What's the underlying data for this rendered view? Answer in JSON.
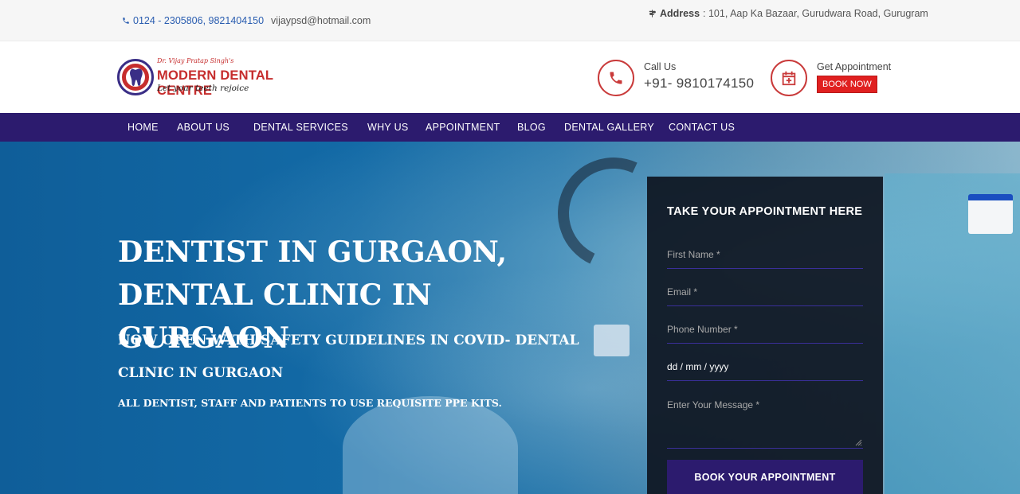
{
  "topbar": {
    "phones": "0124 - 2305806, 9821404150",
    "email": "vijaypsd@hotmail.com",
    "address_label": "Address",
    "address_value": ": 101, Aap Ka Bazaar, Gurudwara Road, Gurugram"
  },
  "logo": {
    "doctor": "Dr. Vijay Pratap Singh's",
    "brand": "MODERN DENTAL CENTRE",
    "tagline": "Let your teeth rejoice"
  },
  "header": {
    "call_label": "Call Us",
    "call_number": "+91- 9810174150",
    "appointment_label": "Get Appointment",
    "book_now": "BOOK NOW"
  },
  "nav": {
    "items": [
      "HOME",
      "ABOUT US",
      "DENTAL SERVICES",
      "WHY US",
      "APPOINTMENT",
      "BLOG",
      "DENTAL GALLERY",
      "CONTACT US"
    ]
  },
  "hero": {
    "title": "DENTIST IN GURGAON, DENTAL CLINIC IN GURGAON",
    "subtitle": "NOW OPEN WITH SAFETY GUIDELINES IN COVID- DENTAL CLINIC IN GURGAON",
    "note": "ALL DENTIST, STAFF AND PATIENTS TO USE REQUISITE PPE KITS."
  },
  "form": {
    "title": "TAKE YOUR APPOINTMENT HERE",
    "first_name_placeholder": "First Name *",
    "email_placeholder": "Email *",
    "phone_placeholder": "Phone Number *",
    "date_value": "dd / mm / yyyy",
    "message_placeholder": "Enter Your Message *",
    "submit": "BOOK YOUR APPOINTMENT"
  },
  "colors": {
    "nav_bg": "#2c1b6e",
    "brand_red": "#c62d2d",
    "book_now_bg": "#e02020"
  }
}
